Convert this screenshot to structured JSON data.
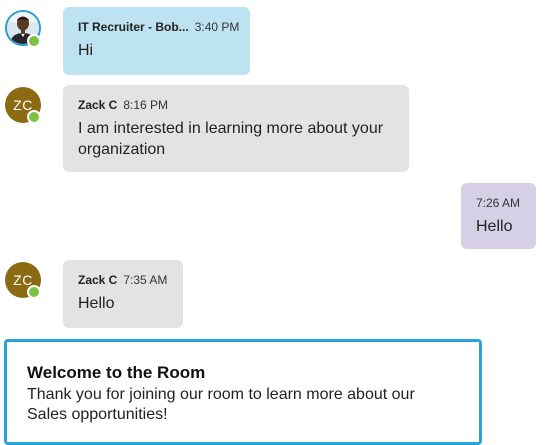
{
  "messages": [
    {
      "sender": "IT Recruiter - Bob...",
      "time": "3:40 PM",
      "text": "Hi",
      "avatar_type": "photo"
    },
    {
      "sender": "Zack C",
      "time": "8:16 PM",
      "text": "I am interested in learning more about your organization",
      "avatar_initials": "ZC"
    },
    {
      "sender": "",
      "time": "7:26 AM",
      "text": "Hello",
      "own_message": true
    },
    {
      "sender": "Zack C",
      "time": "7:35 AM",
      "text": "Hello",
      "avatar_initials": "ZC"
    }
  ],
  "welcome": {
    "title": "Welcome to the Room",
    "body": "Thank you for joining our room to learn more about our Sales opportunities!"
  },
  "colors": {
    "recruiter_bubble": "#bde3f3",
    "other_bubble": "#e4e3e3",
    "own_bubble": "#d6d0e6",
    "presence_online": "#7cc243",
    "avatar_initials_bg": "#8c6a12",
    "accent_border": "#2ca3d6"
  },
  "icons": {
    "presence": "online-status-icon",
    "avatar_photo": "user-photo-icon"
  }
}
